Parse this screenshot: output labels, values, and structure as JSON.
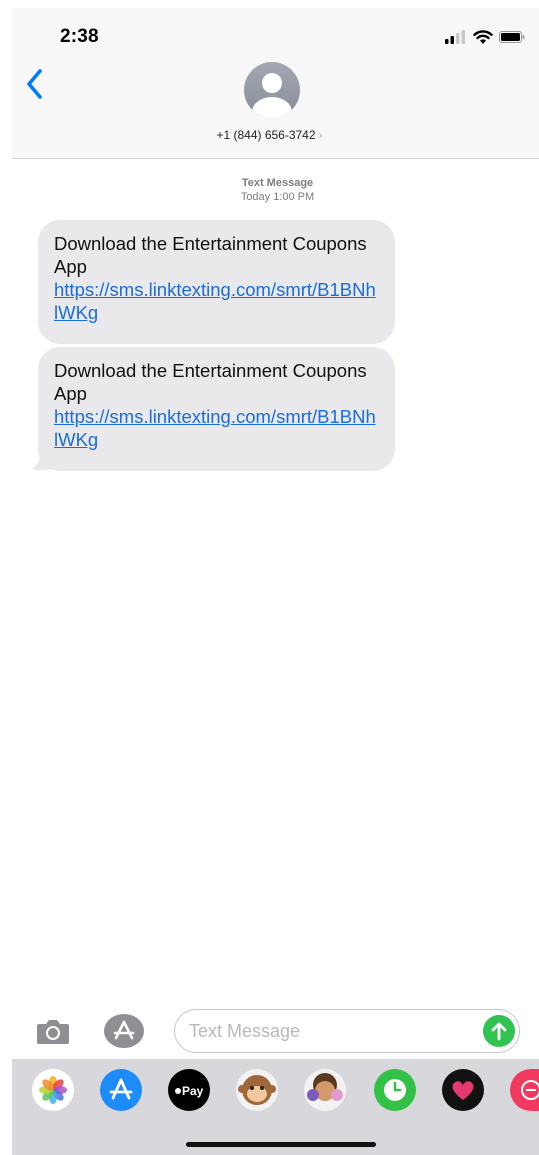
{
  "status_bar": {
    "time": "2:38",
    "icons": [
      "signal-bars-icon",
      "wifi-icon",
      "battery-icon"
    ]
  },
  "header": {
    "back_icon": "chevron-left-icon",
    "avatar_icon": "person-silhouette-icon",
    "contact": "+1 (844) 656-3742",
    "contact_chevron": "›"
  },
  "thread": {
    "meta_type": "Text Message",
    "meta_time": "Today 1:00 PM",
    "messages": [
      {
        "text": "Download the Entertainment Coupons App",
        "link": "https://sms.linktexting.com/smrt/B1BNhlWKg"
      },
      {
        "text": "Download the Entertainment Coupons App",
        "link": "https://sms.linktexting.com/smrt/B1BNhlWKg"
      }
    ]
  },
  "compose": {
    "camera_icon": "camera-icon",
    "apps_icon": "app-store-icon",
    "placeholder": "Text Message",
    "send_icon": "arrow-up-icon"
  },
  "app_drawer": {
    "apps": [
      {
        "name": "photos-icon"
      },
      {
        "name": "app-store-icon"
      },
      {
        "name": "apple-pay-icon",
        "label": "Pay"
      },
      {
        "name": "animoji-monkey-icon"
      },
      {
        "name": "memoji-icon"
      },
      {
        "name": "clock-icon"
      },
      {
        "name": "heart-icon"
      },
      {
        "name": "more-app-icon"
      }
    ]
  },
  "colors": {
    "link": "#1a6ddb",
    "bubble": "#e9e9eb",
    "accent": "#007aff",
    "send": "#30c352"
  }
}
